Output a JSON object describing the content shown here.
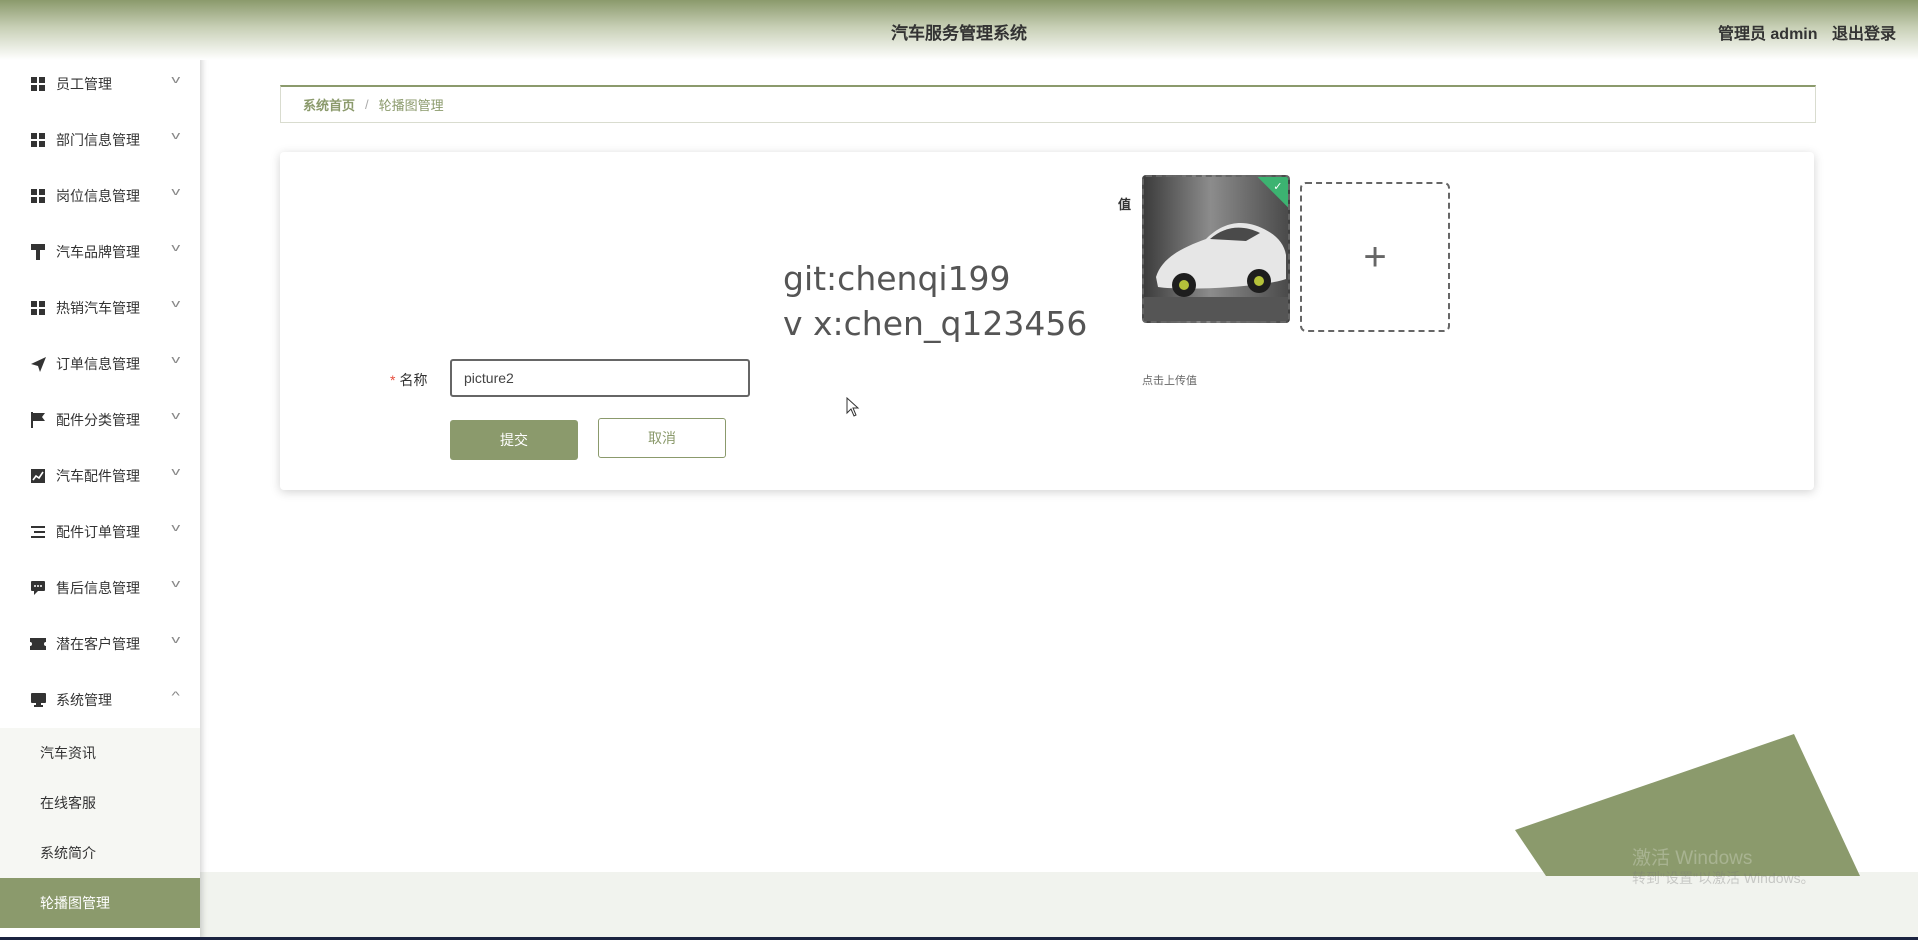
{
  "header": {
    "title": "汽车服务管理系统",
    "user_label": "管理员 admin",
    "logout_label": "退出登录"
  },
  "sidebar": {
    "items": [
      {
        "label": "员工管理",
        "icon": "grid-icon"
      },
      {
        "label": "部门信息管理",
        "icon": "grid-icon"
      },
      {
        "label": "岗位信息管理",
        "icon": "grid-icon"
      },
      {
        "label": "汽车品牌管理",
        "icon": "paint-roller-icon"
      },
      {
        "label": "热销汽车管理",
        "icon": "grid-icon"
      },
      {
        "label": "订单信息管理",
        "icon": "send-icon"
      },
      {
        "label": "配件分类管理",
        "icon": "flag-icon"
      },
      {
        "label": "汽车配件管理",
        "icon": "chart-icon"
      },
      {
        "label": "配件订单管理",
        "icon": "list-icon"
      },
      {
        "label": "售后信息管理",
        "icon": "message-icon"
      },
      {
        "label": "潜在客户管理",
        "icon": "ticket-icon"
      },
      {
        "label": "系统管理",
        "icon": "monitor-icon",
        "expanded": true
      }
    ],
    "submenu": [
      {
        "label": "汽车资讯"
      },
      {
        "label": "在线客服"
      },
      {
        "label": "系统简介"
      },
      {
        "label": "轮播图管理",
        "active": true
      }
    ]
  },
  "breadcrumb": {
    "home": "系统首页",
    "separator": "/",
    "current": "轮播图管理"
  },
  "form": {
    "watermark_line1": "git:chenqi199",
    "watermark_line2": "v x:chen_q123456",
    "name_required_mark": "*",
    "name_label": "名称",
    "name_value": "picture2",
    "value_label": "值",
    "upload_tip": "点击上传值",
    "upload_plus": "+",
    "uploaded_check": "✓",
    "submit_label": "提交",
    "cancel_label": "取消"
  },
  "os_overlay": {
    "activate_title": "激活 Windows",
    "activate_sub": "转到\"设置\"以激活 Windows。"
  },
  "colors": {
    "accent": "#8b9a6c",
    "success": "#3cb371",
    "required": "#e74c3c"
  }
}
